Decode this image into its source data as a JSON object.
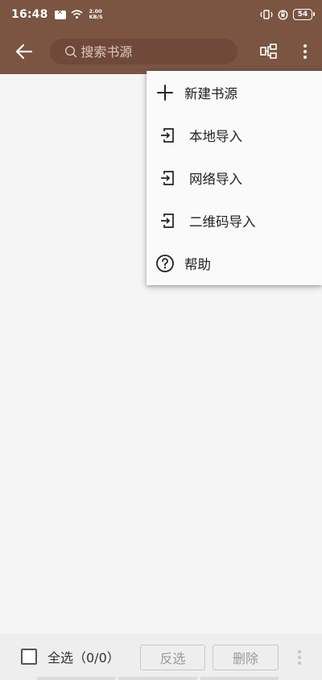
{
  "status_bar": {
    "time": "16:48",
    "net_speed_value": "2.00",
    "net_speed_unit": "KB/S",
    "battery": "54"
  },
  "toolbar": {
    "back_icon": "arrow-left-icon",
    "search_placeholder": "搜索书源",
    "sort_icon": "group-sort-icon",
    "more_icon": "more-vert-icon"
  },
  "menu": {
    "items": [
      {
        "label": "新建书源",
        "icon": "plus-icon"
      },
      {
        "label": "本地导入",
        "icon": "import-icon"
      },
      {
        "label": "网络导入",
        "icon": "import-icon"
      },
      {
        "label": "二维码导入",
        "icon": "import-icon"
      },
      {
        "label": "帮助",
        "icon": "help-icon"
      }
    ]
  },
  "bottom_bar": {
    "select_all_label": "全选（0/0）",
    "invert_label": "反选",
    "delete_label": "删除",
    "more_icon": "more-vert-icon"
  },
  "colors": {
    "primary": "#7b5442",
    "search_bg": "#71493a",
    "menu_bg": "#fafafa",
    "content_bg": "#f5f5f5"
  }
}
